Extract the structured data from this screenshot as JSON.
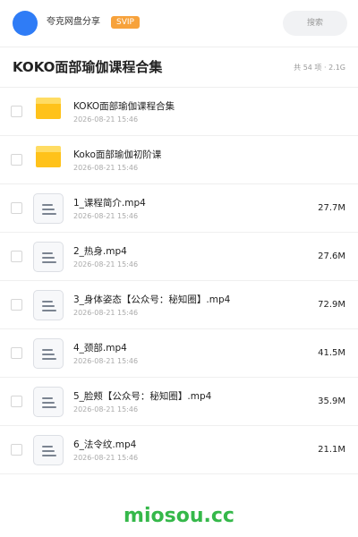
{
  "header": {
    "user_name": "夸克网盘分享",
    "badge": "SVIP",
    "search_placeholder": "搜索"
  },
  "folder": {
    "title": "KOKO面部瑜伽课程合集",
    "meta": "共 54 项 · 2.1G"
  },
  "items": [
    {
      "type": "folder",
      "name": "KOKO面部瑜伽课程合集",
      "date": "2026-08-21 15:46",
      "size": ""
    },
    {
      "type": "folder",
      "name": "Koko面部瑜伽初阶课",
      "date": "2026-08-21 15:46",
      "size": ""
    },
    {
      "type": "file",
      "name": "1_课程简介.mp4",
      "date": "2026-08-21 15:46",
      "size": "27.7M"
    },
    {
      "type": "file",
      "name": "2_热身.mp4",
      "date": "2026-08-21 15:46",
      "size": "27.6M"
    },
    {
      "type": "file",
      "name": "3_身体姿态【公众号：秘知圈】.mp4",
      "date": "2026-08-21 15:46",
      "size": "72.9M"
    },
    {
      "type": "file",
      "name": "4_颈部.mp4",
      "date": "2026-08-21 15:46",
      "size": "41.5M"
    },
    {
      "type": "file",
      "name": "5_脸颊【公众号：秘知圈】.mp4",
      "date": "2026-08-21 15:46",
      "size": "35.9M"
    },
    {
      "type": "file",
      "name": "6_法令纹.mp4",
      "date": "2026-08-21 15:46",
      "size": "21.1M"
    }
  ],
  "watermark": "miosou.cc",
  "colors": {
    "avatar": "#2f7cf6",
    "badge": "#f7a23b",
    "folder": "#ffc21a",
    "watermark": "#35b84a"
  }
}
